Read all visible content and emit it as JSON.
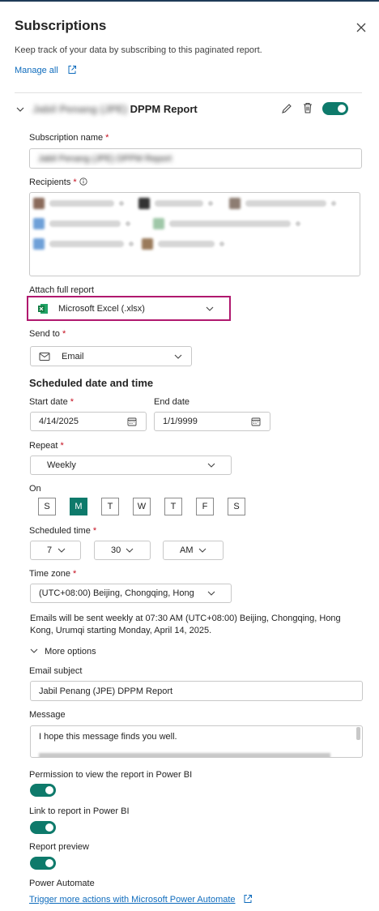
{
  "header": {
    "title": "Subscriptions",
    "description": "Keep track of your data by subscribing to this paginated report.",
    "manage_all": "Manage all"
  },
  "subscription": {
    "name_obscured": "Jabil Penang (JPE)",
    "name_visible": "DPPM Report",
    "enabled": true
  },
  "form": {
    "subscription_name_label": "Subscription name",
    "subscription_name_value": "Jabil Penang (JPE) DPPM Report",
    "recipients_label": "Recipients",
    "attach_label": "Attach full report",
    "attach_value": "Microsoft Excel (.xlsx)",
    "send_to_label": "Send to",
    "send_to_value": "Email",
    "scheduled_heading": "Scheduled date and time",
    "start_date_label": "Start date",
    "start_date_value": "4/14/2025",
    "end_date_label": "End date",
    "end_date_value": "1/1/9999",
    "repeat_label": "Repeat",
    "repeat_value": "Weekly",
    "on_label": "On",
    "days": [
      "S",
      "M",
      "T",
      "W",
      "T",
      "F",
      "S"
    ],
    "selected_day_index": 1,
    "scheduled_time_label": "Scheduled time",
    "hour": "7",
    "minute": "30",
    "ampm": "AM",
    "timezone_label": "Time zone",
    "timezone_value": "(UTC+08:00) Beijing, Chongqing, Hong",
    "schedule_summary": "Emails will be sent weekly at 07:30 AM (UTC+08:00) Beijing, Chongqing, Hong Kong, Urumqi starting Monday, April 14, 2025.",
    "more_options": "More options",
    "email_subject_label": "Email subject",
    "email_subject_value": "Jabil Penang (JPE) DPPM Report",
    "message_label": "Message",
    "message_line1": "I hope this message finds you well.",
    "permission_label": "Permission to view the report in Power BI",
    "link_label": "Link to report in Power BI",
    "preview_label": "Report preview",
    "power_automate_label": "Power Automate",
    "power_automate_link": "Trigger more actions with Microsoft Power Automate"
  },
  "colors": {
    "accent": "#0e7a6b",
    "link": "#0f6cbd",
    "required": "#c50f1f",
    "highlight": "#b0186e",
    "excel": "#107c41"
  }
}
